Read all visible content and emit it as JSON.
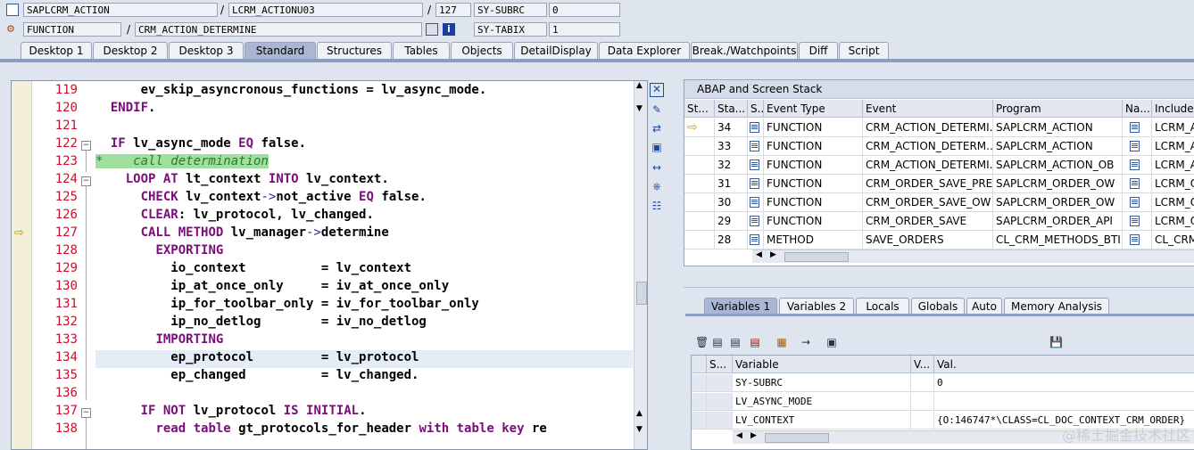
{
  "header": {
    "program": "SAPLCRM_ACTION",
    "include": "LCRM_ACTIONU03",
    "line": "127",
    "sy_subrc_label": "SY-SUBRC",
    "sy_subrc_value": "0",
    "type": "FUNCTION",
    "name": "CRM_ACTION_DETERMINE",
    "sy_tabix_label": "SY-TABIX",
    "sy_tabix_value": "1",
    "sep": "/"
  },
  "tabs": [
    "Desktop 1",
    "Desktop 2",
    "Desktop 3",
    "Standard",
    "Structures",
    "Tables",
    "Objects",
    "DetailDisplay",
    "Data Explorer",
    "Break./Watchpoints",
    "Diff",
    "Script"
  ],
  "active_tab": "Standard",
  "code": {
    "lines": [
      {
        "n": "119",
        "t": "      ev_skip_asyncronous_functions = lv_async_mode."
      },
      {
        "n": "120",
        "t": "  ENDIF."
      },
      {
        "n": "121",
        "t": ""
      },
      {
        "n": "122",
        "t": "  IF lv_async_mode EQ false."
      },
      {
        "n": "123",
        "t": "*    call determination"
      },
      {
        "n": "124",
        "t": "    LOOP AT lt_context INTO lv_context."
      },
      {
        "n": "125",
        "t": "      CHECK lv_context->not_active EQ false."
      },
      {
        "n": "126",
        "t": "      CLEAR: lv_protocol, lv_changed."
      },
      {
        "n": "127",
        "t": "      CALL METHOD lv_manager->determine"
      },
      {
        "n": "128",
        "t": "        EXPORTING"
      },
      {
        "n": "129",
        "t": "          io_context          = lv_context"
      },
      {
        "n": "130",
        "t": "          ip_at_once_only     = iv_at_once_only"
      },
      {
        "n": "131",
        "t": "          ip_for_toolbar_only = iv_for_toolbar_only"
      },
      {
        "n": "132",
        "t": "          ip_no_detlog        = iv_no_detlog"
      },
      {
        "n": "133",
        "t": "        IMPORTING"
      },
      {
        "n": "134",
        "t": "          ep_protocol         = lv_protocol"
      },
      {
        "n": "135",
        "t": "          ep_changed          = lv_changed."
      },
      {
        "n": "136",
        "t": ""
      },
      {
        "n": "137",
        "t": "      IF NOT lv_protocol IS INITIAL."
      },
      {
        "n": "138",
        "t": "        read table gt_protocols_for_header with table key re"
      }
    ]
  },
  "stack": {
    "title": "ABAP and Screen Stack",
    "columns": [
      "St...",
      "Sta...",
      "S...",
      "Event Type",
      "Event",
      "Program",
      "Na...",
      "Include"
    ],
    "rows": [
      {
        "level": "34",
        "type": "FUNCTION",
        "event": "CRM_ACTION_DETERMI...",
        "program": "SAPLCRM_ACTION",
        "include": "LCRM_AC",
        "current": true
      },
      {
        "level": "33",
        "type": "FUNCTION",
        "event": "CRM_ACTION_DETERM...",
        "program": "SAPLCRM_ACTION",
        "include": "LCRM_AC",
        "current": false
      },
      {
        "level": "32",
        "type": "FUNCTION",
        "event": "CRM_ACTION_DETERMI...",
        "program": "SAPLCRM_ACTION_OB",
        "include": "LCRM_AC",
        "current": false
      },
      {
        "level": "31",
        "type": "FUNCTION",
        "event": "CRM_ORDER_SAVE_PRE...",
        "program": "SAPLCRM_ORDER_OW",
        "include": "LCRM_O",
        "current": false
      },
      {
        "level": "30",
        "type": "FUNCTION",
        "event": "CRM_ORDER_SAVE_OW",
        "program": "SAPLCRM_ORDER_OW",
        "include": "LCRM_O",
        "current": false
      },
      {
        "level": "29",
        "type": "FUNCTION",
        "event": "CRM_ORDER_SAVE",
        "program": "SAPLCRM_ORDER_API",
        "include": "LCRM_O",
        "current": false
      },
      {
        "level": "28",
        "type": "METHOD",
        "event": "SAVE_ORDERS",
        "program": "CL_CRM_METHODS_BTIL...",
        "include": "CL_CRM",
        "current": false
      }
    ]
  },
  "var_tabs": [
    "Variables 1",
    "Variables 2",
    "Locals",
    "Globals",
    "Auto",
    "Memory Analysis"
  ],
  "active_var_tab": "Variables 1",
  "variables": {
    "columns": [
      "S...",
      "Variable",
      "V...",
      "Val."
    ],
    "rows": [
      {
        "name": "SY-SUBRC",
        "value": "0"
      },
      {
        "name": "LV_ASYNC_MODE",
        "value": ""
      },
      {
        "name": "LV_CONTEXT",
        "value": "{O:146747*\\CLASS=CL_DOC_CONTEXT_CRM_ORDER}"
      }
    ]
  },
  "watermark": "@稀土掘金技术社区"
}
